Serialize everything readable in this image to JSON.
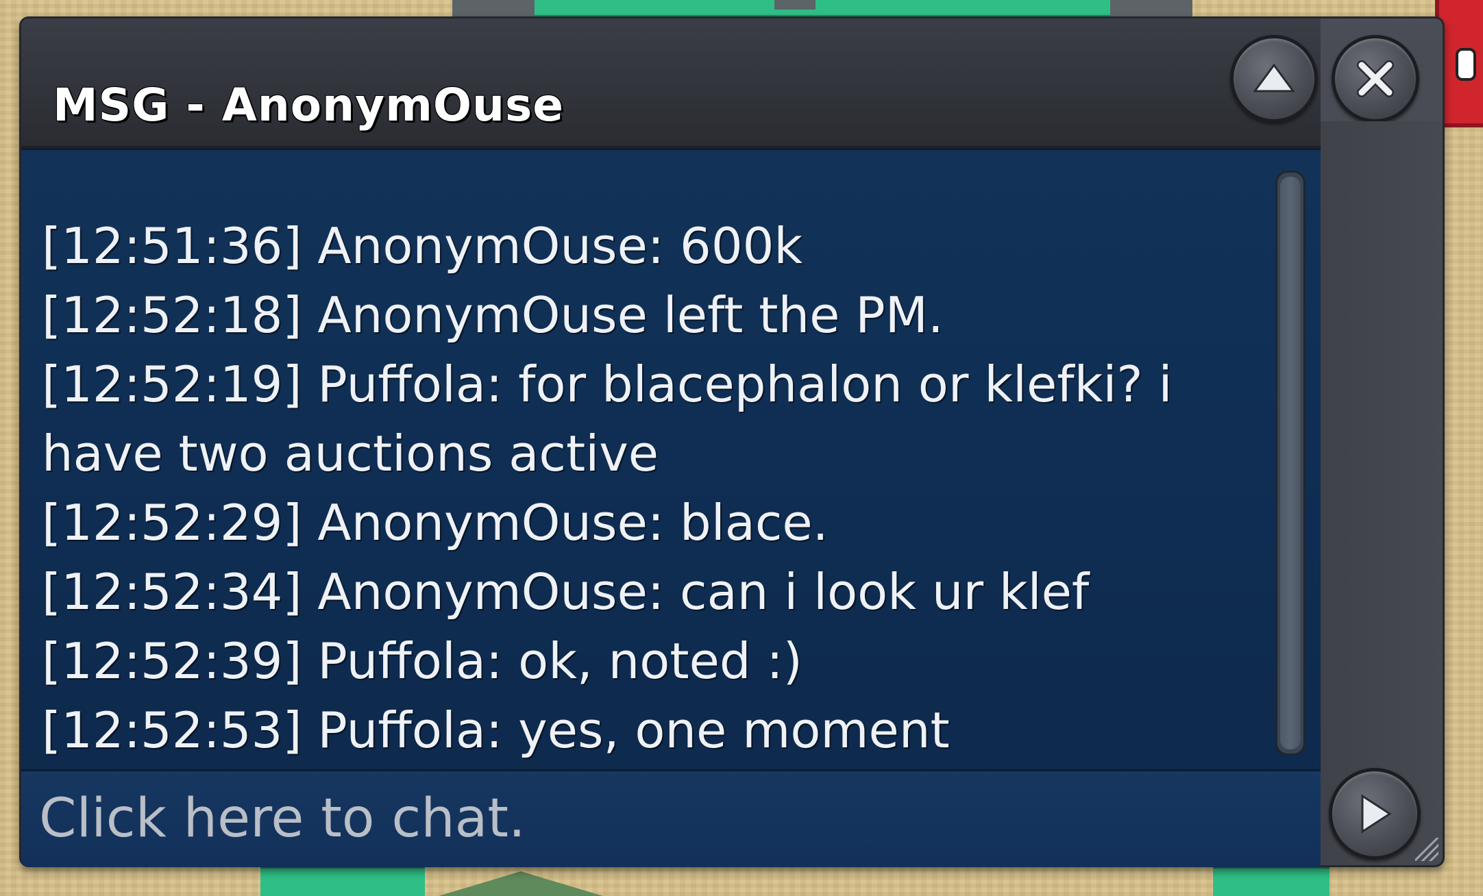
{
  "window": {
    "title": "MSG - AnonymOuse"
  },
  "controls": {
    "minimize_icon": "chevron-up-icon",
    "close_icon": "close-icon",
    "send_icon": "play-arrow-icon"
  },
  "messages": [
    "[12:51:36] AnonymOuse: 600k",
    "[12:52:18] AnonymOuse left the PM.",
    "[12:52:19] Puffola: for blacephalon or klefki? i have two auctions active",
    "[12:52:29] AnonymOuse: blace.",
    "[12:52:34] AnonymOuse: can i look ur klef",
    "[12:52:39] Puffola: ok, noted :)",
    "[12:52:53] Puffola: yes, one moment"
  ],
  "input": {
    "placeholder": "Click here to chat.",
    "value": ""
  },
  "colors": {
    "chat_background": "#0f2d52",
    "window_frame": "#45484f",
    "text": "#eef1f6"
  }
}
